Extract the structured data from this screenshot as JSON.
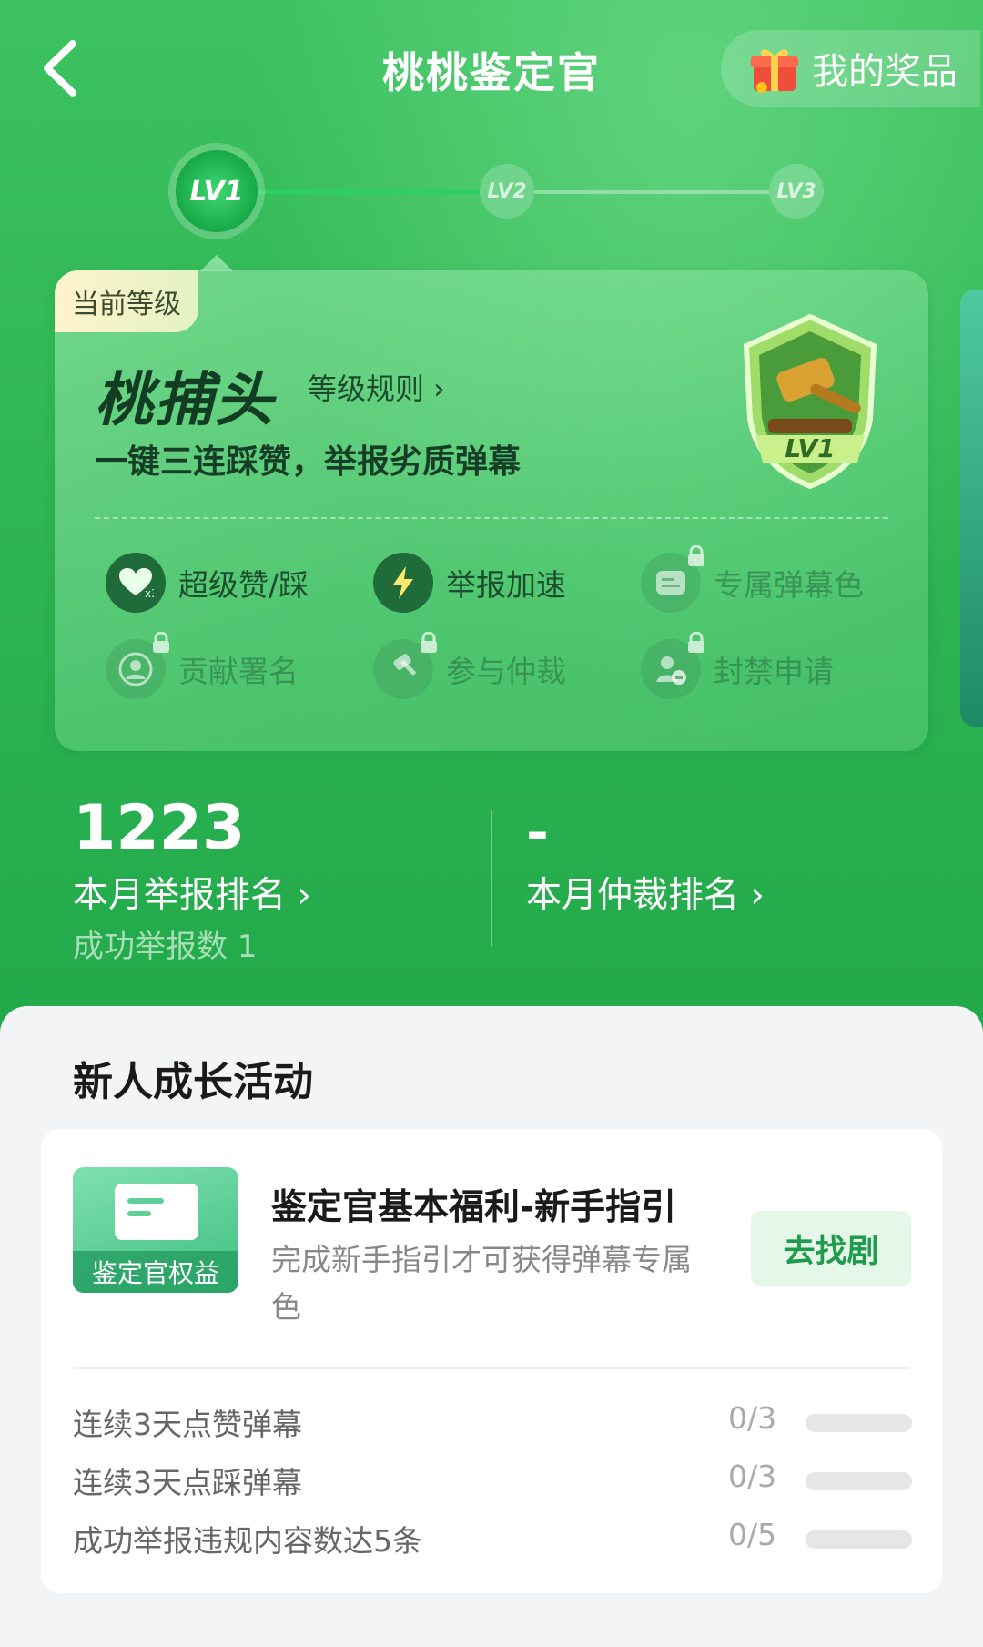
{
  "header": {
    "title": "桃桃鉴定官",
    "prize_label": "我的奖品"
  },
  "levels": [
    {
      "label": "LV1",
      "active": true
    },
    {
      "label": "LV2",
      "active": false
    },
    {
      "label": "LV3",
      "active": false
    }
  ],
  "card": {
    "current_tag": "当前等级",
    "rank_name": "桃捕头",
    "rules_link": "等级规则 ›",
    "subtitle": "一键三连踩赞，举报劣质弹幕",
    "badge_label": "LV1",
    "perks": [
      {
        "label": "超级赞/踩",
        "icon": "heart-x3-icon",
        "unlocked": true
      },
      {
        "label": "举报加速",
        "icon": "lightning-icon",
        "unlocked": true
      },
      {
        "label": "专属弹幕色",
        "icon": "danmaku-icon",
        "unlocked": false
      },
      {
        "label": "贡献署名",
        "icon": "user-circle-icon",
        "unlocked": false
      },
      {
        "label": "参与仲裁",
        "icon": "gavel-icon",
        "unlocked": false
      },
      {
        "label": "封禁申请",
        "icon": "user-ban-icon",
        "unlocked": false
      }
    ]
  },
  "stats": {
    "report_rank_value": "1223",
    "report_rank_label": "本月举报排名 ›",
    "report_count": "成功举报数 1",
    "arbitration_rank_value": "-",
    "arbitration_rank_label": "本月仲裁排名 ›"
  },
  "activity": {
    "section_title": "新人成长活动",
    "thumb_caption": "鉴定官权益",
    "title": "鉴定官基本福利-新手指引",
    "description": "完成新手指引才可获得弹幕专属色",
    "button_label": "去找剧",
    "tasks": [
      {
        "name": "连续3天点赞弹幕",
        "progress": "0/3",
        "fraction": 0
      },
      {
        "name": "连续3天点踩弹幕",
        "progress": "0/3",
        "fraction": 0
      },
      {
        "name": "成功举报违规内容数达5条",
        "progress": "0/5",
        "fraction": 0
      }
    ]
  },
  "colors": {
    "brand_green": "#2fb656",
    "button_text": "#1e9c4c"
  }
}
